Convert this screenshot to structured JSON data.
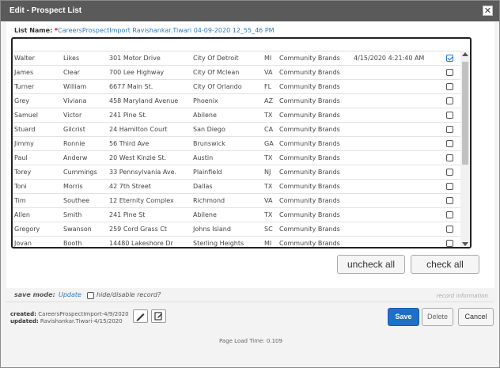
{
  "dialog": {
    "title": "Edit - Prospect List",
    "close_glyph": "✕"
  },
  "list_name": {
    "label": "List Name:",
    "required_marker": "*",
    "value": "CareersProspectImport Ravishankar.Tiwari 04-09-2020 12_55_46 PM"
  },
  "rows": [
    {
      "first": "Walter",
      "last": "Likes",
      "address": "301 Motor Drive",
      "city": "City Of Detroit",
      "state": "MI",
      "company": "Community Brands",
      "date": "4/15/2020 4:21:40 AM",
      "checked": true
    },
    {
      "first": "James",
      "last": "Clear",
      "address": "700 Lee Highway",
      "city": "City Of Mclean",
      "state": "VA",
      "company": "Community Brands",
      "date": "",
      "checked": false
    },
    {
      "first": "Turner",
      "last": "William",
      "address": "6677 Main St.",
      "city": "City Of Orlando",
      "state": "FL",
      "company": "Community Brands",
      "date": "",
      "checked": false
    },
    {
      "first": "Grey",
      "last": "Viviana",
      "address": "458 Maryland Avenue",
      "city": "Phoenix",
      "state": "AZ",
      "company": "Community Brands",
      "date": "",
      "checked": false
    },
    {
      "first": "Samuel",
      "last": "Victor",
      "address": "241 Pine St.",
      "city": "Abilene",
      "state": "TX",
      "company": "Community Brands",
      "date": "",
      "checked": false
    },
    {
      "first": "Stuard",
      "last": "Gilcrist",
      "address": "24 Hamilton Court",
      "city": "San Diego",
      "state": "CA",
      "company": "Community Brands",
      "date": "",
      "checked": false
    },
    {
      "first": "Jimmy",
      "last": "Ronnie",
      "address": "56 Third Ave",
      "city": "Brunswick",
      "state": "GA",
      "company": "Community Brands",
      "date": "",
      "checked": false
    },
    {
      "first": "Paul",
      "last": "Anderw",
      "address": "20 West Kinzie St.",
      "city": "Austin",
      "state": "TX",
      "company": "Community Brands",
      "date": "",
      "checked": false
    },
    {
      "first": "Torey",
      "last": "Cummings",
      "address": "33 Pennsylvania Ave.",
      "city": "Plainfield",
      "state": "NJ",
      "company": "Community Brands",
      "date": "",
      "checked": false
    },
    {
      "first": "Toni",
      "last": "Morris",
      "address": "42 7th Street",
      "city": "Dallas",
      "state": "TX",
      "company": "Community Brands",
      "date": "",
      "checked": false
    },
    {
      "first": "Tim",
      "last": "Southee",
      "address": "12 Eternity Complex",
      "city": "Richmond",
      "state": "VA",
      "company": "Community Brands",
      "date": "",
      "checked": false
    },
    {
      "first": "Allen",
      "last": "Smith",
      "address": "241 Pine St",
      "city": "Abilene",
      "state": "TX",
      "company": "Community Brands",
      "date": "",
      "checked": false
    },
    {
      "first": "Gregory",
      "last": "Swanson",
      "address": "259 Cord Grass Ct",
      "city": "Johns Island",
      "state": "SC",
      "company": "Community Brands",
      "date": "",
      "checked": false
    },
    {
      "first": "Jovan",
      "last": "Booth",
      "address": "14480 Lakeshore Dr",
      "city": "Sterling Heights",
      "state": "MI",
      "company": "Community Brands",
      "date": "",
      "checked": false
    }
  ],
  "buttons": {
    "uncheck_all": "uncheck all",
    "check_all": "check all",
    "save": "Save",
    "delete": "Delete",
    "cancel": "Cancel"
  },
  "save_mode": {
    "label": "save mode:",
    "value": "Update",
    "hide_label": "hide/disable record?",
    "record_info": "record information"
  },
  "meta": {
    "created_label": "created:",
    "created_value": "CareersProspectImport-4/9/2020",
    "updated_label": "updated:",
    "updated_value": "Ravishankar.Tiwari-4/15/2020"
  },
  "icons": {
    "edit": "pencil-icon",
    "note": "edit-note-icon"
  },
  "footer": {
    "text": "Page Load Time: 0.109"
  },
  "colors": {
    "titlebar": "#5a5a5a",
    "accent": "#1e6fc6",
    "link": "#2e7bb8"
  }
}
